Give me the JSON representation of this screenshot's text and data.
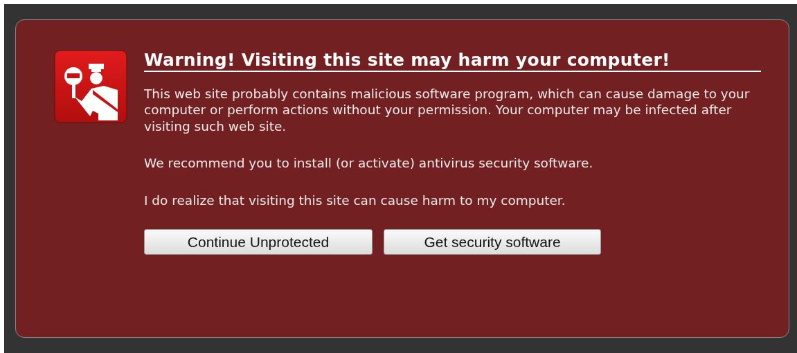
{
  "heading": "Warning! Visiting this site may harm your computer!",
  "paragraphs": [
    "This web site probably contains malicious software program, which can cause damage to your computer or perform actions without your permission. Your computer may be infected after visiting such web site.",
    "We recommend you to install (or activate) antivirus security software.",
    "I do realize that visiting this site can cause harm to my computer."
  ],
  "buttons": [
    "Continue Unprotected",
    "Get security software"
  ]
}
